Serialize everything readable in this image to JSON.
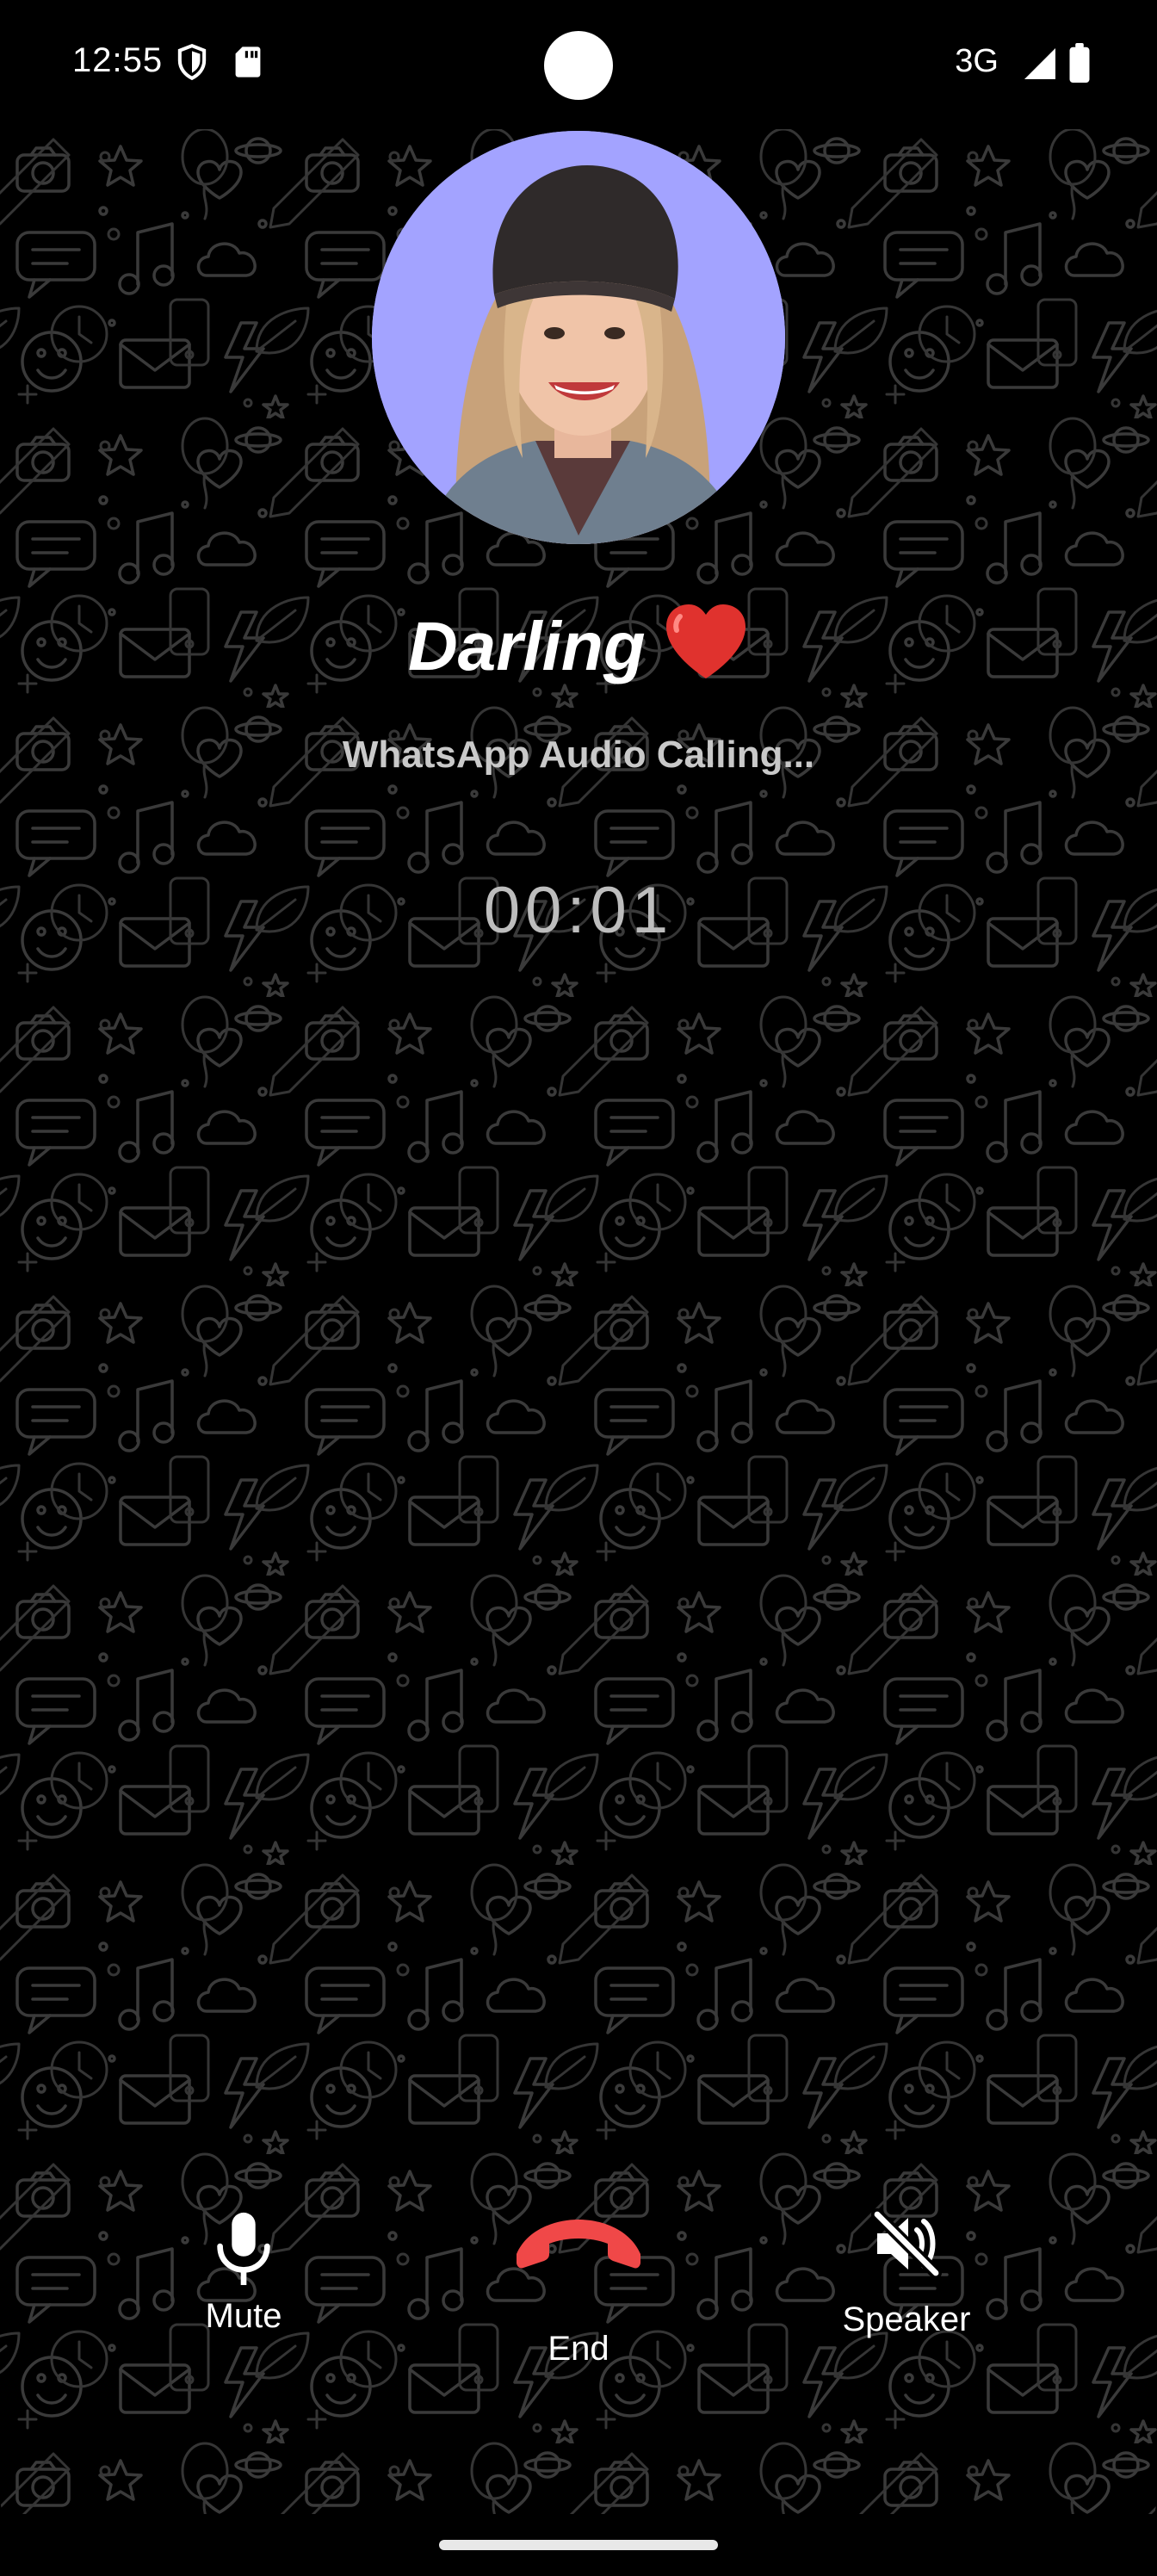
{
  "status_bar": {
    "time": "12:55",
    "network": "3G",
    "icons": [
      "shield-icon",
      "sd-card-icon",
      "signal-icon",
      "battery-icon"
    ]
  },
  "call": {
    "contact_name": "Darling",
    "name_emoji": "heart-icon",
    "status": "WhatsApp Audio Calling...",
    "timer": "00:01"
  },
  "controls": {
    "mute_label": "Mute",
    "end_label": "End",
    "speaker_label": "Speaker"
  },
  "colors": {
    "background": "#000000",
    "avatar_background": "#a3a3ff",
    "end_call": "#f04848",
    "doodle": "#3a3a3a",
    "heart": "#e0322e"
  }
}
